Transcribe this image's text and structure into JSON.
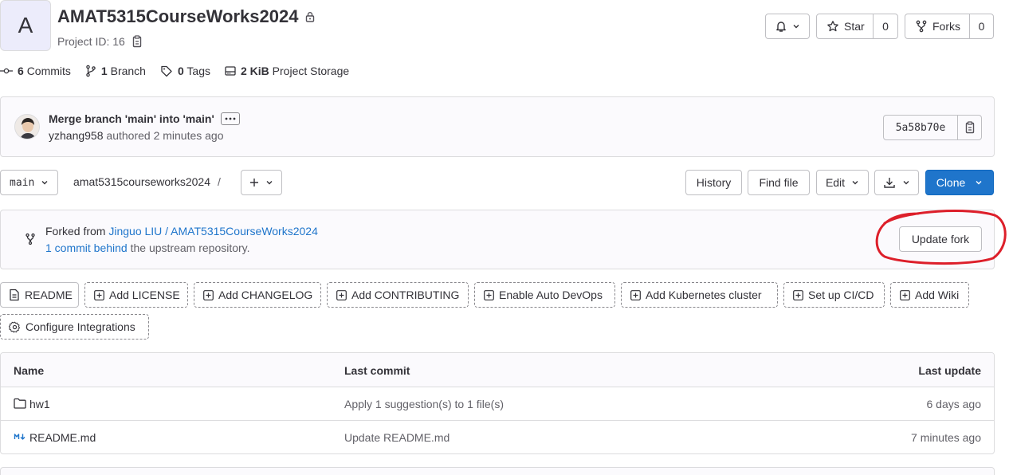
{
  "project": {
    "avatar_letter": "A",
    "name": "AMAT5315CourseWorks2024",
    "id_label": "Project ID: 16"
  },
  "header_actions": {
    "star_label": "Star",
    "star_count": "0",
    "forks_label": "Forks",
    "forks_count": "0"
  },
  "stats": {
    "commits_count": "6",
    "commits_label": "Commits",
    "branch_count": "1",
    "branch_label": "Branch",
    "tags_count": "0",
    "tags_label": "Tags",
    "storage_size": "2 KiB",
    "storage_label": "Project Storage"
  },
  "last_commit": {
    "message": "Merge branch 'main' into 'main'",
    "author": "yzhang958",
    "authored_text": "authored 2 minutes ago",
    "sha": "5a58b70e"
  },
  "toolbar": {
    "branch": "main",
    "path": "amat5315courseworks2024",
    "path_separator": "/",
    "history_label": "History",
    "find_file_label": "Find file",
    "edit_label": "Edit",
    "clone_label": "Clone"
  },
  "fork_info": {
    "prefix": "Forked from",
    "source_link": "Jinguo LIU / AMAT5315CourseWorks2024",
    "behind_link": "1 commit behind",
    "behind_suffix": "the upstream repository.",
    "update_label": "Update fork"
  },
  "quick_actions": [
    {
      "label": "README"
    },
    {
      "label": "Add LICENSE"
    },
    {
      "label": "Add CHANGELOG"
    },
    {
      "label": "Add CONTRIBUTING"
    },
    {
      "label": "Enable Auto DevOps"
    },
    {
      "label": "Add Kubernetes cluster"
    },
    {
      "label": "Set up CI/CD"
    },
    {
      "label": "Add Wiki"
    },
    {
      "label": "Configure Integrations"
    }
  ],
  "file_table": {
    "headers": {
      "name": "Name",
      "last_commit": "Last commit",
      "last_update": "Last update"
    },
    "rows": [
      {
        "name": "hw1",
        "commit": "Apply 1 suggestion(s) to 1 file(s)",
        "updated": "6 days ago",
        "icon": "folder-icon"
      },
      {
        "name": "README.md",
        "commit": "Update README.md",
        "updated": "7 minutes ago",
        "icon": "markdown-icon"
      }
    ]
  },
  "colors": {
    "primary": "#1f75cb",
    "annotation": "#dd1f2a"
  }
}
